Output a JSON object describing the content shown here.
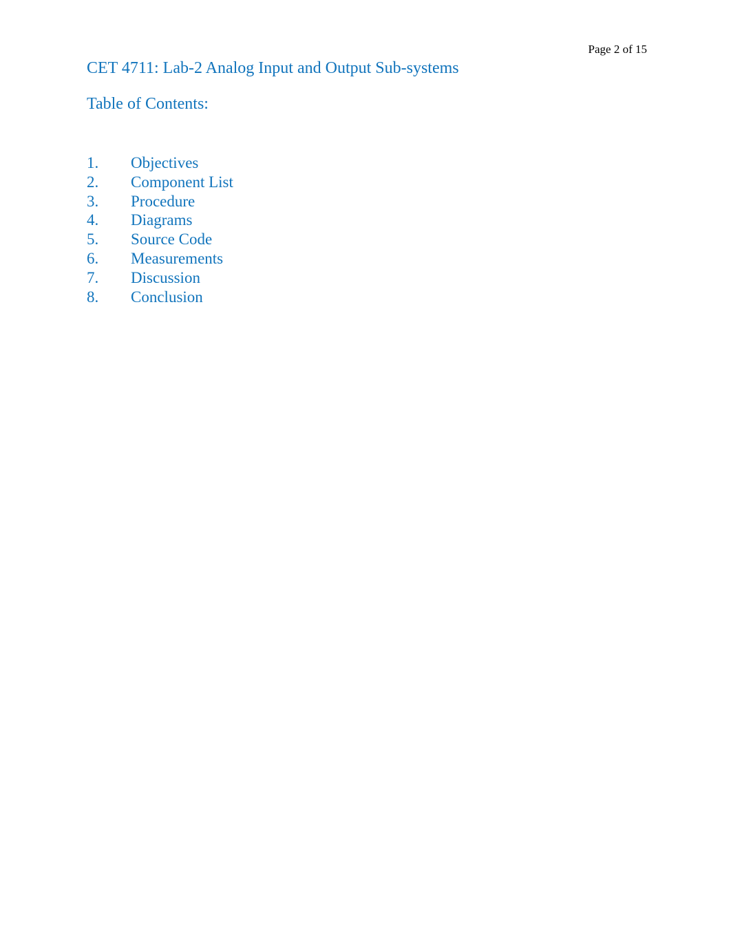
{
  "document": {
    "page_header": "Page 2 of 15",
    "title": "CET 4711: Lab-2 Analog Input and Output Sub-systems",
    "toc_heading": "Table of Contents:",
    "accent_color": "#1174BC",
    "header_color": "#000000",
    "background_color": "#FFFFFF",
    "toc_items": [
      {
        "number": "1.",
        "label": "Objectives"
      },
      {
        "number": "2.",
        "label": "Component List"
      },
      {
        "number": "3.",
        "label": "Procedure"
      },
      {
        "number": "4.",
        "label": "Diagrams"
      },
      {
        "number": "5.",
        "label": "Source Code"
      },
      {
        "number": "6.",
        "label": "Measurements"
      },
      {
        "number": "7.",
        "label": "Discussion"
      },
      {
        "number": "8.",
        "label": "Conclusion"
      }
    ]
  }
}
